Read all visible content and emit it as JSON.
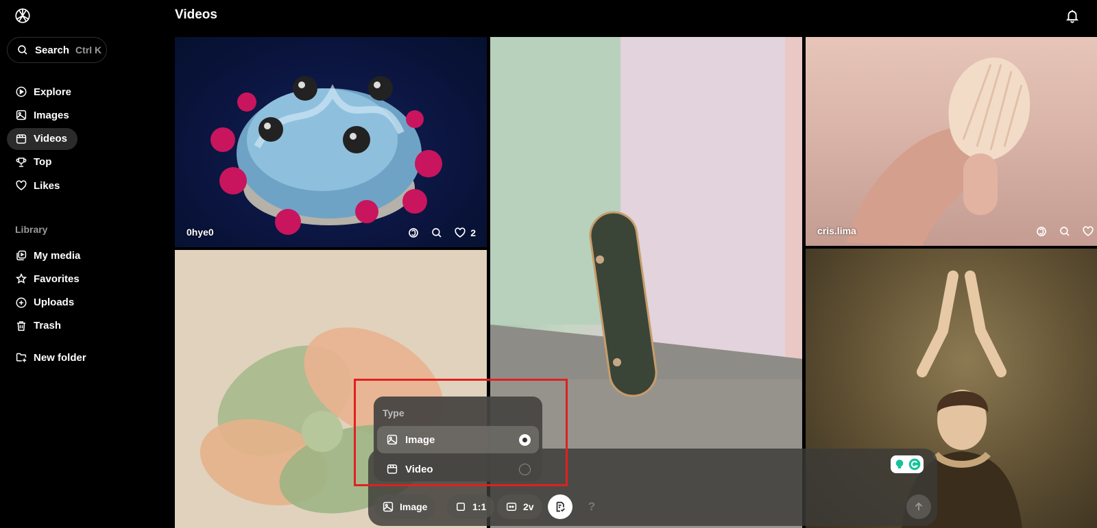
{
  "sidebar": {
    "search": {
      "label": "Search",
      "shortcut": "Ctrl K"
    },
    "nav": [
      {
        "label": "Explore",
        "icon": "play-circle-icon"
      },
      {
        "label": "Images",
        "icon": "image-icon"
      },
      {
        "label": "Videos",
        "icon": "video-icon",
        "active": true
      },
      {
        "label": "Top",
        "icon": "trophy-icon"
      },
      {
        "label": "Likes",
        "icon": "heart-icon"
      }
    ],
    "library_label": "Library",
    "library": [
      {
        "label": "My media",
        "icon": "media-icon"
      },
      {
        "label": "Favorites",
        "icon": "star-icon"
      },
      {
        "label": "Uploads",
        "icon": "plus-circle-icon"
      },
      {
        "label": "Trash",
        "icon": "trash-icon"
      }
    ],
    "new_folder": {
      "label": "New folder",
      "icon": "folder-plus-icon"
    }
  },
  "header": {
    "title": "Videos"
  },
  "tiles": [
    {
      "author": "0hye0",
      "likes": "2"
    },
    {
      "author": "cris.lima"
    }
  ],
  "composer": {
    "type_chip": "Image",
    "ratio_chip": "1:1",
    "variants_chip": "2v",
    "help": "?"
  },
  "type_popup": {
    "title": "Type",
    "options": [
      {
        "label": "Image",
        "selected": true
      },
      {
        "label": "Video",
        "selected": false
      }
    ]
  },
  "colors": {
    "accent_highlight": "#e02020",
    "active_nav_bg": "#2b2b2b"
  }
}
